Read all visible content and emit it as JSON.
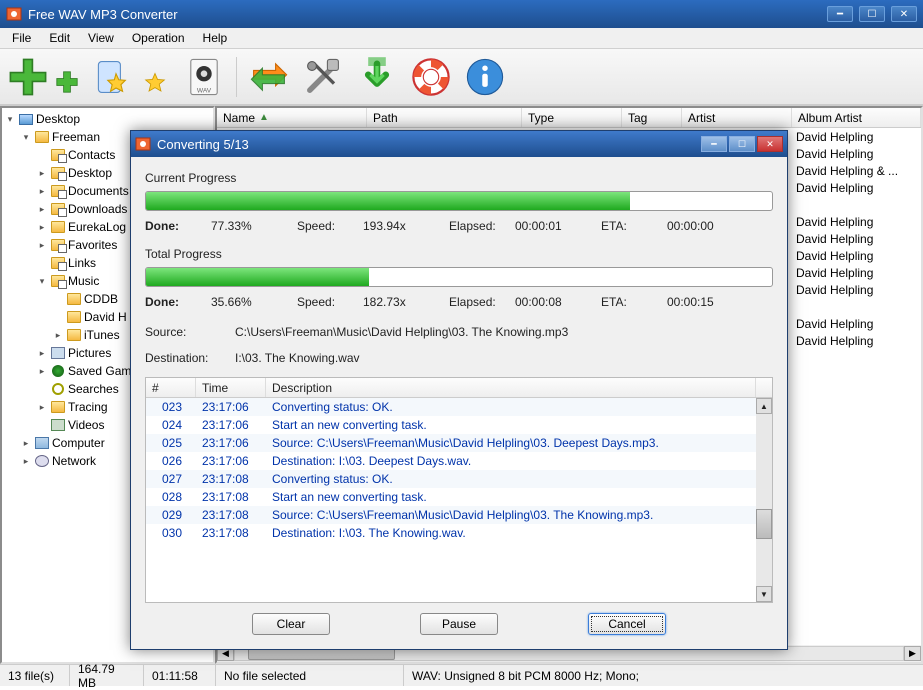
{
  "main": {
    "title": "Free WAV MP3 Converter",
    "menu": [
      "File",
      "Edit",
      "View",
      "Operation",
      "Help"
    ]
  },
  "tree": {
    "root": "Desktop",
    "items": [
      {
        "label": "Freeman",
        "expanded": true,
        "children": [
          {
            "label": "Contacts"
          },
          {
            "label": "Desktop"
          },
          {
            "label": "Documents"
          },
          {
            "label": "Downloads"
          },
          {
            "label": "EurekaLog"
          },
          {
            "label": "Favorites"
          },
          {
            "label": "Links"
          },
          {
            "label": "Music",
            "expanded": true,
            "children": [
              {
                "label": "CDDB"
              },
              {
                "label": "David H"
              },
              {
                "label": "iTunes"
              }
            ]
          },
          {
            "label": "Pictures"
          },
          {
            "label": "Saved Gam"
          },
          {
            "label": "Searches"
          },
          {
            "label": "Tracing"
          },
          {
            "label": "Videos"
          }
        ]
      },
      {
        "label": "Computer"
      },
      {
        "label": "Network"
      }
    ]
  },
  "list": {
    "columns": [
      "Name",
      "Path",
      "Type",
      "Tag",
      "Artist",
      "Album Artist"
    ],
    "sort_column": "Name",
    "album_artists": [
      "David Helpling",
      "David Helpling",
      "David Helpling & ...",
      "David Helpling",
      "",
      "David Helpling",
      "David Helpling",
      "David Helpling",
      "David Helpling",
      "David Helpling",
      "",
      "David Helpling",
      "David Helpling"
    ]
  },
  "dialog": {
    "title": "Converting 5/13",
    "current": {
      "label": "Current Progress",
      "done_label": "Done:",
      "done": "77.33%",
      "speed_label": "Speed:",
      "speed": "193.94x",
      "elapsed_label": "Elapsed:",
      "elapsed": "00:00:01",
      "eta_label": "ETA:",
      "eta": "00:00:00",
      "percent": 77.33
    },
    "total": {
      "label": "Total Progress",
      "done_label": "Done:",
      "done": "35.66%",
      "speed_label": "Speed:",
      "speed": "182.73x",
      "elapsed_label": "Elapsed:",
      "elapsed": "00:00:08",
      "eta_label": "ETA:",
      "eta": "00:00:15",
      "percent": 35.66
    },
    "source_label": "Source:",
    "source": "C:\\Users\\Freeman\\Music\\David Helpling\\03. The Knowing.mp3",
    "destination_label": "Destination:",
    "destination": "I:\\03. The Knowing.wav",
    "log_headers": [
      "#",
      "Time",
      "Description"
    ],
    "log": [
      {
        "n": "023",
        "t": "23:17:06",
        "d": "Converting status: OK."
      },
      {
        "n": "024",
        "t": "23:17:06",
        "d": "Start an new converting task."
      },
      {
        "n": "025",
        "t": "23:17:06",
        "d": "Source:  C:\\Users\\Freeman\\Music\\David Helpling\\03. Deepest Days.mp3."
      },
      {
        "n": "026",
        "t": "23:17:06",
        "d": "Destination: I:\\03. Deepest Days.wav."
      },
      {
        "n": "027",
        "t": "23:17:08",
        "d": "Converting status: OK."
      },
      {
        "n": "028",
        "t": "23:17:08",
        "d": "Start an new converting task."
      },
      {
        "n": "029",
        "t": "23:17:08",
        "d": "Source:  C:\\Users\\Freeman\\Music\\David Helpling\\03. The Knowing.mp3."
      },
      {
        "n": "030",
        "t": "23:17:08",
        "d": "Destination: I:\\03. The Knowing.wav."
      }
    ],
    "buttons": {
      "clear": "Clear",
      "pause": "Pause",
      "cancel": "Cancel"
    }
  },
  "status": {
    "files": "13 file(s)",
    "size": "164.79 MB",
    "duration": "01:11:58",
    "selection": "No file selected",
    "format": "WAV:   Unsigned 8 bit PCM  8000 Hz;  Mono;"
  }
}
